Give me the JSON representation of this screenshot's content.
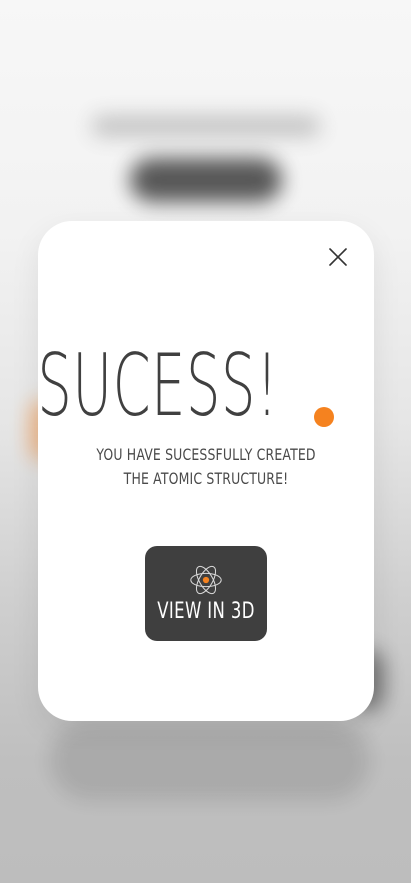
{
  "modal": {
    "headline": "SUCESS!",
    "message_line_1": "YOU HAVE SUCESSFULLY CREATED",
    "message_line_2": "THE ATOMIC STRUCTURE!",
    "button_label": "VIEW IN 3D"
  },
  "icons": {
    "close": "close-icon",
    "atom": "atom-icon"
  },
  "colors": {
    "accent": "#f5821f",
    "dark": "#3f3f3f",
    "modal_bg": "#ffffff",
    "text": "#404040"
  }
}
